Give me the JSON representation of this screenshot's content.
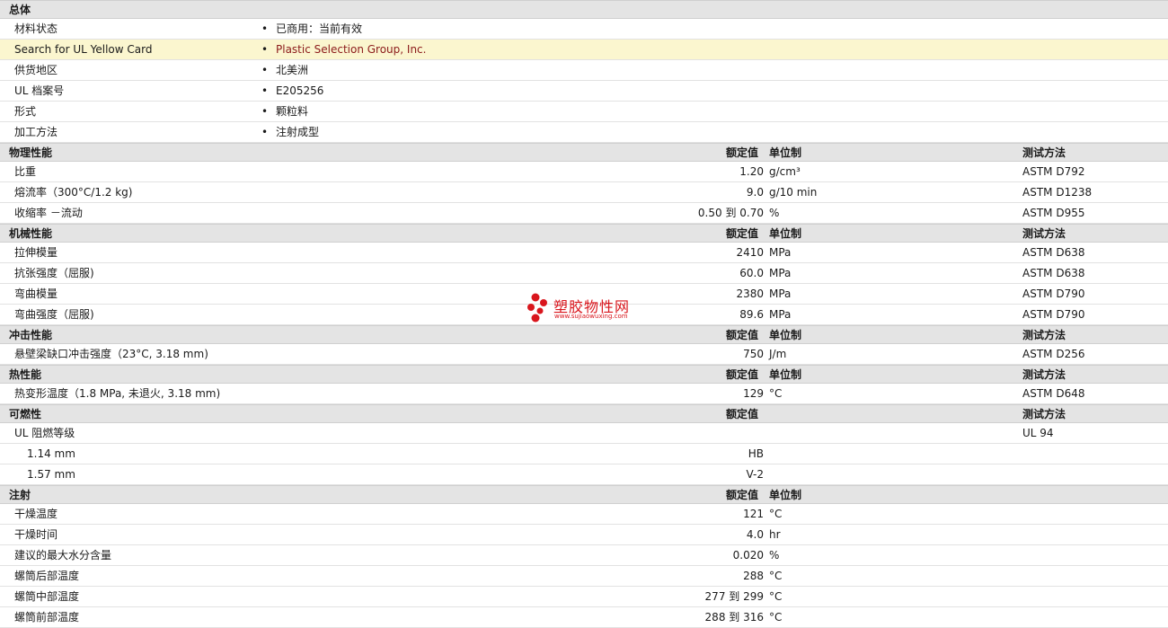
{
  "general": {
    "title": "总体",
    "rows": [
      {
        "label": "材料状态",
        "value": "已商用：当前有效",
        "link": false
      },
      {
        "label": "Search for UL Yellow Card",
        "value": "Plastic Selection Group, Inc.",
        "link": true
      },
      {
        "label": "供货地区",
        "value": "北美洲",
        "link": false
      },
      {
        "label": "UL 档案号",
        "value": "E205256",
        "link": false
      },
      {
        "label": "形式",
        "value": "颗粒料",
        "link": false
      },
      {
        "label": "加工方法",
        "value": "注射成型",
        "link": false
      }
    ]
  },
  "headers": {
    "nominal": "额定值",
    "unit": "单位制",
    "test": "测试方法"
  },
  "sections": [
    {
      "title": "物理性能",
      "show_unit": true,
      "show_test": true,
      "rows": [
        {
          "label": "比重",
          "value": "1.20",
          "unit": "g/cm³",
          "test": "ASTM D792"
        },
        {
          "label": "熔流率（300°C/1.2 kg)",
          "value": "9.0",
          "unit": "g/10 min",
          "test": "ASTM D1238"
        },
        {
          "label": "收缩率 －流动",
          "value": "0.50 到  0.70",
          "unit": "%",
          "test": "ASTM D955"
        }
      ]
    },
    {
      "title": "机械性能",
      "show_unit": true,
      "show_test": true,
      "rows": [
        {
          "label": "拉伸模量",
          "value": "2410",
          "unit": "MPa",
          "test": "ASTM D638"
        },
        {
          "label": "抗张强度（屈服)",
          "value": "60.0",
          "unit": "MPa",
          "test": "ASTM D638"
        },
        {
          "label": "弯曲模量",
          "value": "2380",
          "unit": "MPa",
          "test": "ASTM D790"
        },
        {
          "label": "弯曲强度（屈服)",
          "value": "89.6",
          "unit": "MPa",
          "test": "ASTM D790"
        }
      ]
    },
    {
      "title": "冲击性能",
      "show_unit": true,
      "show_test": true,
      "rows": [
        {
          "label": "悬壁梁缺口冲击强度（23°C, 3.18 mm)",
          "value": "750",
          "unit": "J/m",
          "test": "ASTM D256"
        }
      ]
    },
    {
      "title": "热性能",
      "show_unit": true,
      "show_test": true,
      "rows": [
        {
          "label": "热变形温度（1.8 MPa, 未退火, 3.18 mm)",
          "value": "129",
          "unit": "°C",
          "test": "ASTM D648"
        }
      ]
    },
    {
      "title": "可燃性",
      "show_unit": false,
      "show_test": true,
      "rows": [
        {
          "label": "UL 阻燃等级",
          "value": "",
          "unit": "",
          "test": "UL 94"
        },
        {
          "label": "1.14 mm",
          "value": "HB",
          "unit": "",
          "test": "",
          "indent": true
        },
        {
          "label": "1.57 mm",
          "value": "V-2",
          "unit": "",
          "test": "",
          "indent": true
        }
      ]
    },
    {
      "title": "注射",
      "show_unit": true,
      "show_test": false,
      "rows": [
        {
          "label": "干燥温度",
          "value": "121",
          "unit": "°C",
          "test": ""
        },
        {
          "label": "干燥时间",
          "value": "4.0",
          "unit": "hr",
          "test": ""
        },
        {
          "label": "建议的最大水分含量",
          "value": "0.020",
          "unit": "%",
          "test": ""
        },
        {
          "label": "螺筒后部温度",
          "value": "288",
          "unit": "°C",
          "test": ""
        },
        {
          "label": "螺筒中部温度",
          "value": "277 到  299",
          "unit": "°C",
          "test": ""
        },
        {
          "label": "螺筒前部温度",
          "value": "288 到  316",
          "unit": "°C",
          "test": ""
        }
      ]
    }
  ],
  "watermark": {
    "title": "塑胶物性网",
    "url": "www.sujiaowuxing.com"
  },
  "colors": {
    "section_bg": "#e4e4e4",
    "highlight_bg": "#fbf6cf",
    "link": "#8b1a1a",
    "watermark": "#d9161d"
  }
}
